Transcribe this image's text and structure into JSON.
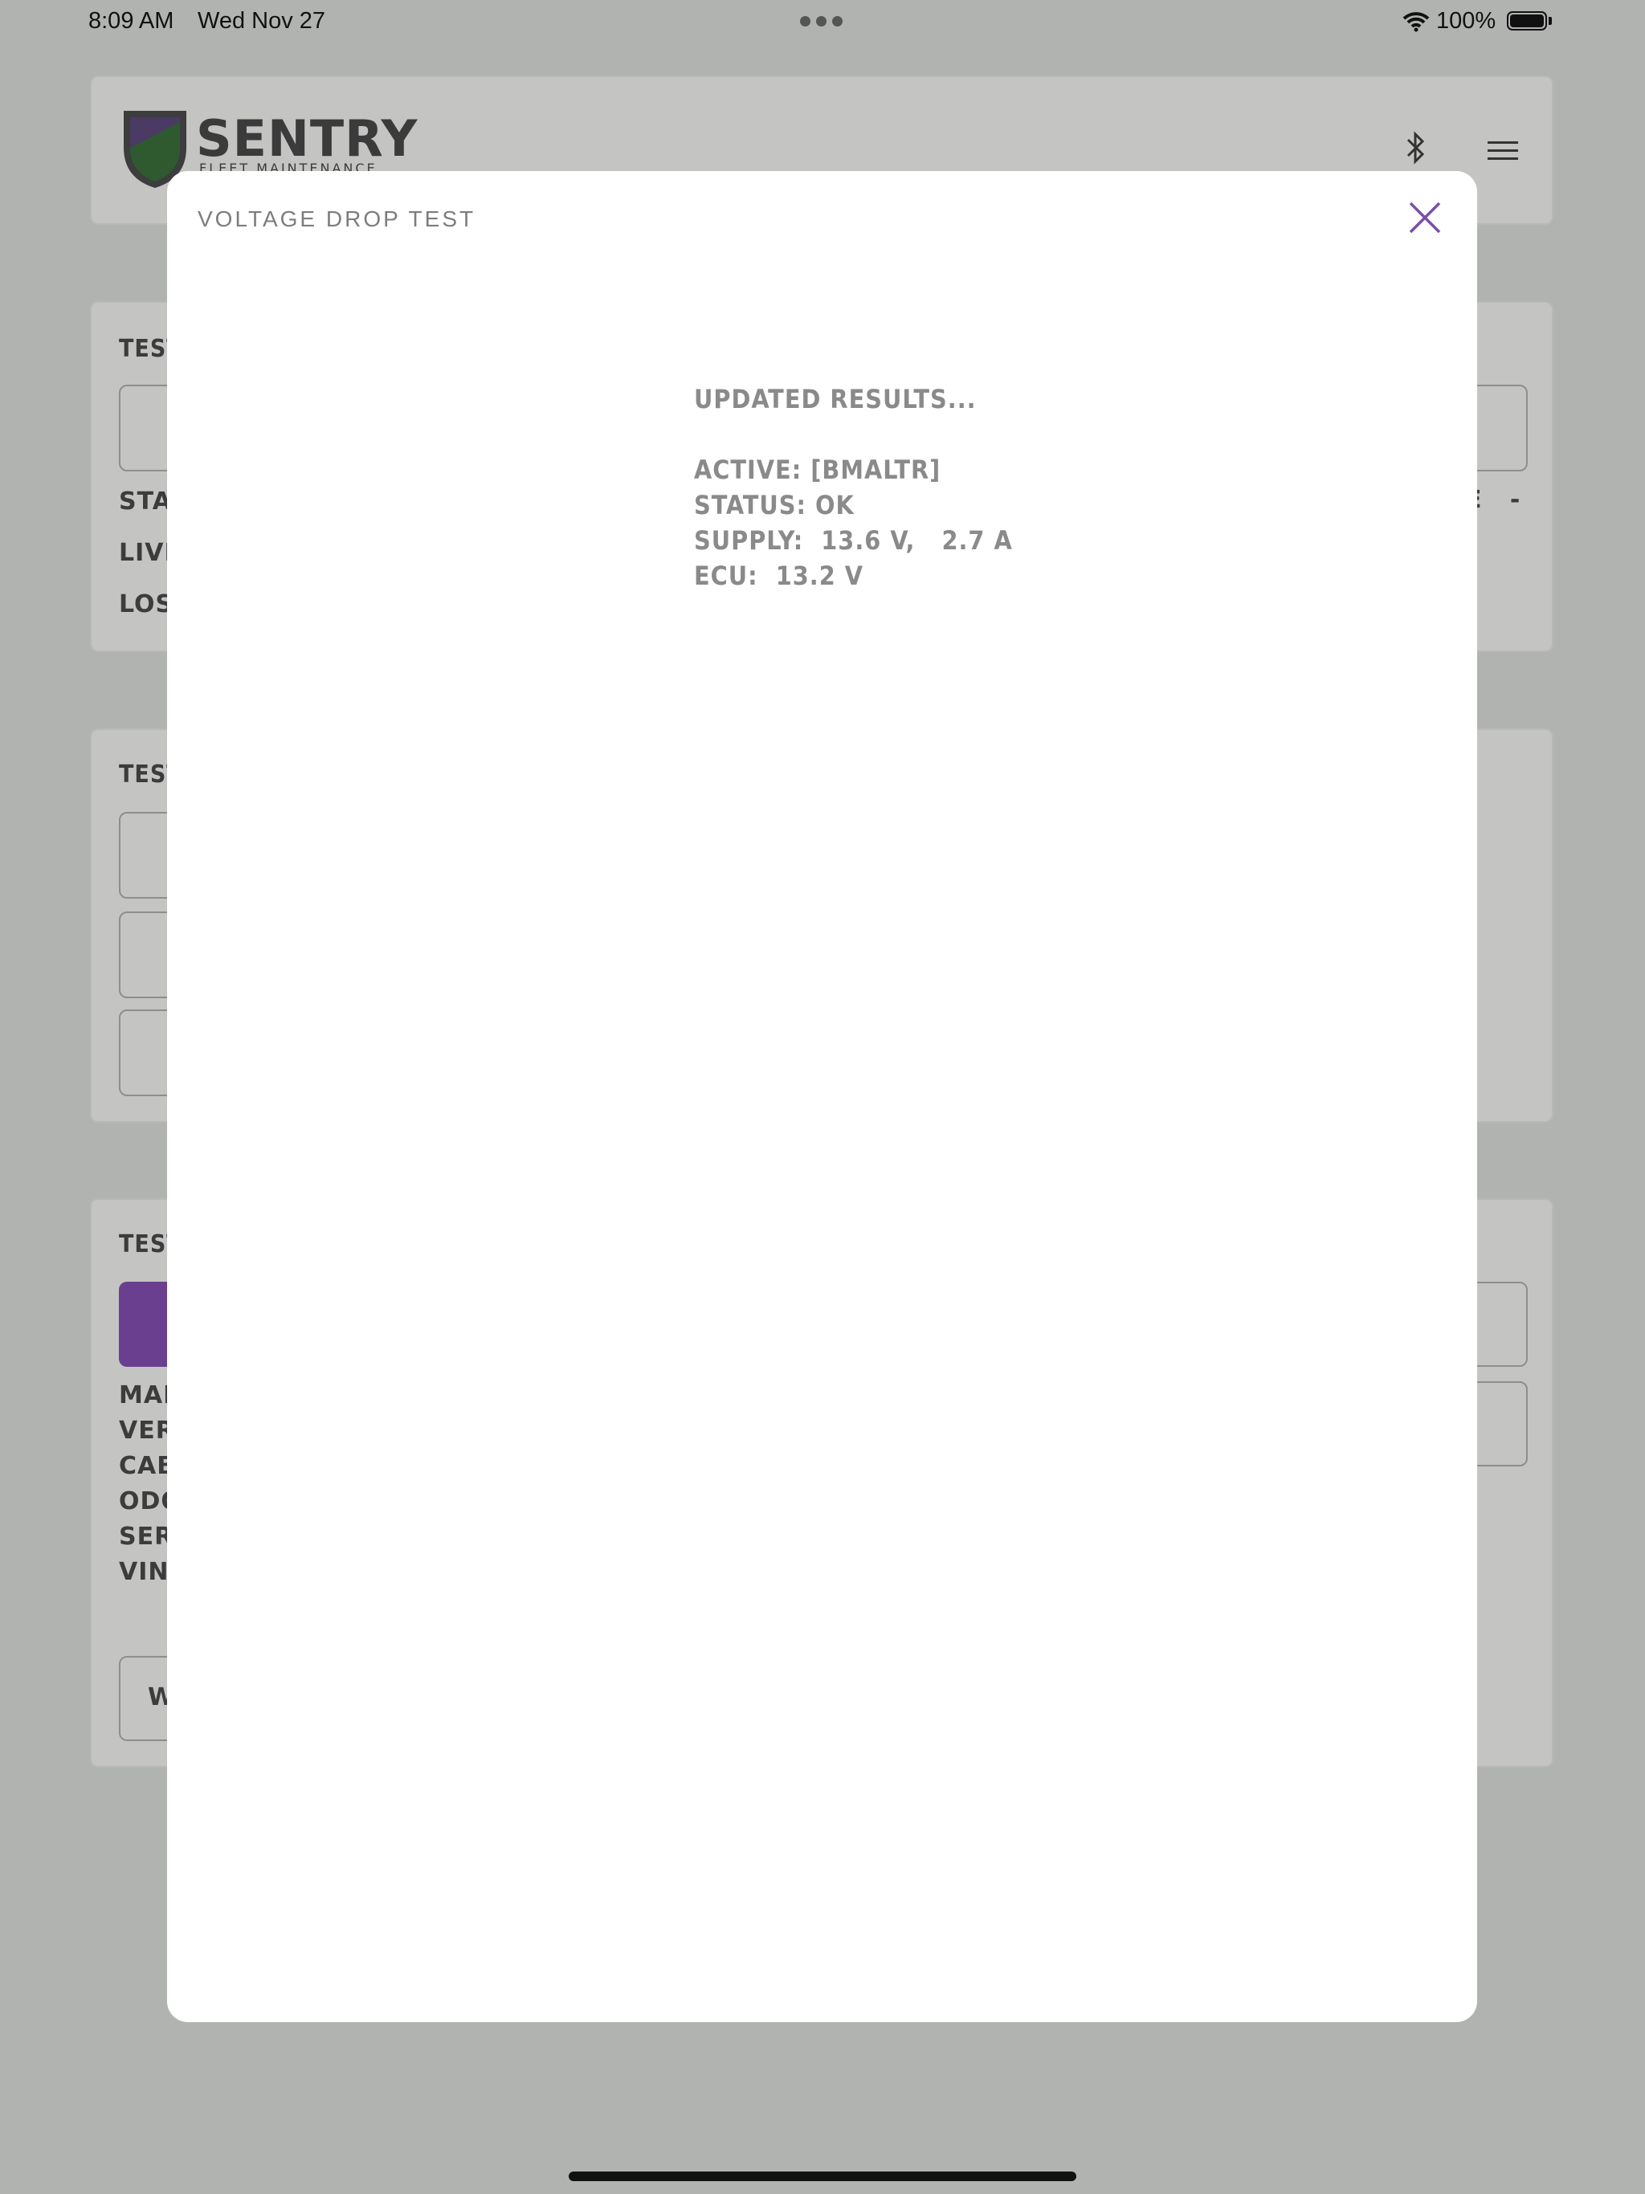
{
  "status_bar": {
    "time": "8:09 AM",
    "date": "Wed Nov 27",
    "battery": "100%"
  },
  "header": {
    "logo_text": "SENTRY",
    "logo_sub": "FLEET MAINTENANCE"
  },
  "background": {
    "section1": {
      "label": "TEST",
      "rows": [
        "STAR",
        "LIVE",
        "LOSS"
      ],
      "right_frag": "E   -"
    },
    "section2": {
      "label": "TEST"
    },
    "section3": {
      "label": "TEST",
      "rows": [
        "MAKE",
        "VERS",
        "CAB",
        "ODOM",
        "SERI",
        "VIN:"
      ],
      "button_frag": "W"
    }
  },
  "modal": {
    "title": "VOLTAGE DROP TEST",
    "close_icon": "close-icon",
    "results": {
      "heading": "UPDATED RESULTS...",
      "lines": [
        "ACTIVE: [BMALTR]",
        "STATUS: OK",
        "SUPPLY:  13.6 V,   2.7 A",
        "ECU:  13.2 V"
      ]
    }
  },
  "colors": {
    "accent": "#7b4fa7",
    "overlay": "#b1b3b1"
  }
}
